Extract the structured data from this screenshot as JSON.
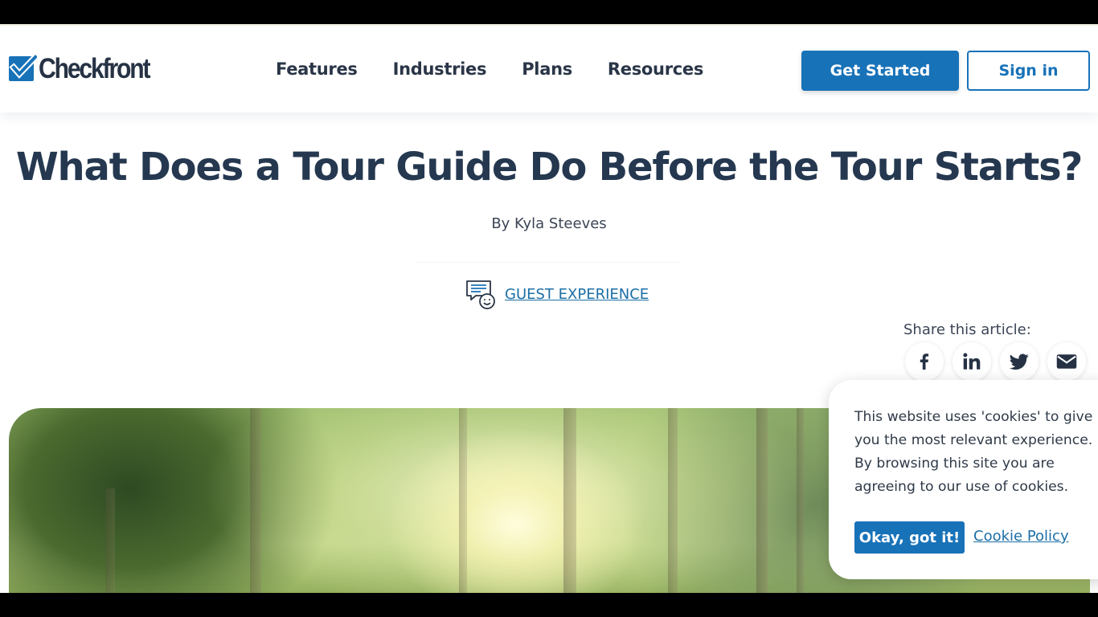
{
  "header": {
    "logo_text": "Checkfront",
    "nav": [
      "Features",
      "Industries",
      "Plans",
      "Resources"
    ],
    "get_started_label": "Get Started",
    "sign_in_label": "Sign in"
  },
  "article": {
    "title": "What Does a Tour Guide Do Before the Tour Starts?",
    "byline": "By Kyla Steeves",
    "category": "GUEST EXPERIENCE",
    "share_label": "Share this article:",
    "share_icons": [
      "facebook-icon",
      "linkedin-icon",
      "twitter-icon",
      "email-icon"
    ]
  },
  "cookie_banner": {
    "message": "This website uses 'cookies' to give you the most relevant experience. By browsing this site you are agreeing to our use of cookies.",
    "ok_label": "Okay, got it!",
    "policy_label": "Cookie Policy"
  },
  "colors": {
    "brand_blue": "#1872b8",
    "heading": "#253850",
    "link": "#1c6fa6"
  }
}
